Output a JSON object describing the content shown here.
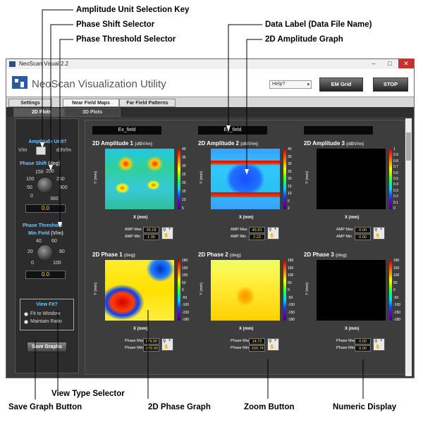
{
  "annotations": {
    "amp_unit_key": "Amplitude Unit Selection Key",
    "phase_shift": "Phase Shift Selector",
    "phase_threshold": "Phase Threshold Selector",
    "data_label": "Data Label (Data File Name)",
    "amp_graph": "2D Amplitude Graph",
    "save_btn": "Save Graph Button",
    "view_type": "View Type Selector",
    "phase_graph": "2D Phase Graph",
    "zoom_btn": "Zoom Button",
    "numeric": "Numeric Display"
  },
  "window": {
    "title": "NeoScan Visual 2.2",
    "app_title": "NeoScan Visualization Utility",
    "help_value": "Help?",
    "btn_em_grid": "EM Grid",
    "btn_stop": "STOP"
  },
  "tabs": [
    "Settings",
    "Near Field Maps",
    "Far Field Patterns"
  ],
  "subtabs": [
    "2D Plots",
    "3D Plots"
  ],
  "left_panel": {
    "amp_unit_label": "Amplitude Unit?",
    "unit_left": "V/m",
    "unit_right": "dBV/m",
    "phase_shift_label": "Phase Shift",
    "phase_shift_unit": "(deg)",
    "ps_ticks": [
      "150",
      "200",
      "100",
      "250",
      "50",
      "300",
      "0",
      "360"
    ],
    "phase_shift_value": "0.0",
    "threshold_label": "Phase Threshold",
    "min_field_label": "Min Field",
    "min_field_unit": "(V/m)",
    "th_ticks": [
      "40",
      "60",
      "20",
      "80",
      "0",
      "100"
    ],
    "threshold_value": "0.0",
    "view_fit_label": "View Fit?",
    "fit_window": "Fit to Window",
    "maintain_ratio": "Maintain Ratio",
    "save_label": "Save Graphs"
  },
  "files": [
    "Ex_field",
    "Ey_field",
    ""
  ],
  "amp_titles": [
    "2D Amplitude 1",
    "2D Amplitude 2",
    "2D Amplitude 3"
  ],
  "amp_unit": "(dBV/m)",
  "phase_titles": [
    "2D Phase 1",
    "2D Phase 2",
    "2D Phase 3"
  ],
  "phase_unit": "(deg)",
  "y_label": "Y (mm)",
  "x_label": "X (mm)",
  "amp_scales": [
    [
      "40",
      "35",
      "30",
      "25",
      "20",
      "15",
      "10",
      "5"
    ],
    [
      "40",
      "35",
      "30",
      "25",
      "20",
      "15",
      "10",
      "5",
      "2"
    ],
    [
      "1",
      "0.9",
      "0.8",
      "0.7",
      "0.6",
      "0.5",
      "0.4",
      "0.3",
      "0.2",
      "0.1",
      "0"
    ]
  ],
  "phase_scale": [
    "180",
    "150",
    "100",
    "50",
    "0",
    "-50",
    "-100",
    "-150",
    "-180"
  ],
  "amp_controls": [
    {
      "max_label": "AMP Max",
      "max": "35.18",
      "min_label": "AMP Min",
      "min": "1.35"
    },
    {
      "max_label": "AMP Max",
      "max": "46.83",
      "min_label": "AMP Min",
      "min": "2.23"
    },
    {
      "max_label": "AMP Max",
      "max": "0.00",
      "min_label": "AMP Min",
      "min": "0.00"
    }
  ],
  "phase_controls": [
    {
      "max_label": "Phase Max",
      "max": "179.90",
      "min_label": "Phase Min",
      "min": "-179.99"
    },
    {
      "max_label": "Phase Max",
      "max": "14.72",
      "min_label": "Phase Min",
      "min": "-156.74"
    },
    {
      "max_label": "Phase Max",
      "max": "0.00",
      "min_label": "Phase Min",
      "min": "0.00"
    }
  ],
  "colors": {
    "accent_label": "#6cc7ff",
    "numeric_text": "#ffd84a",
    "panel_bg": "#3a3a3a"
  }
}
